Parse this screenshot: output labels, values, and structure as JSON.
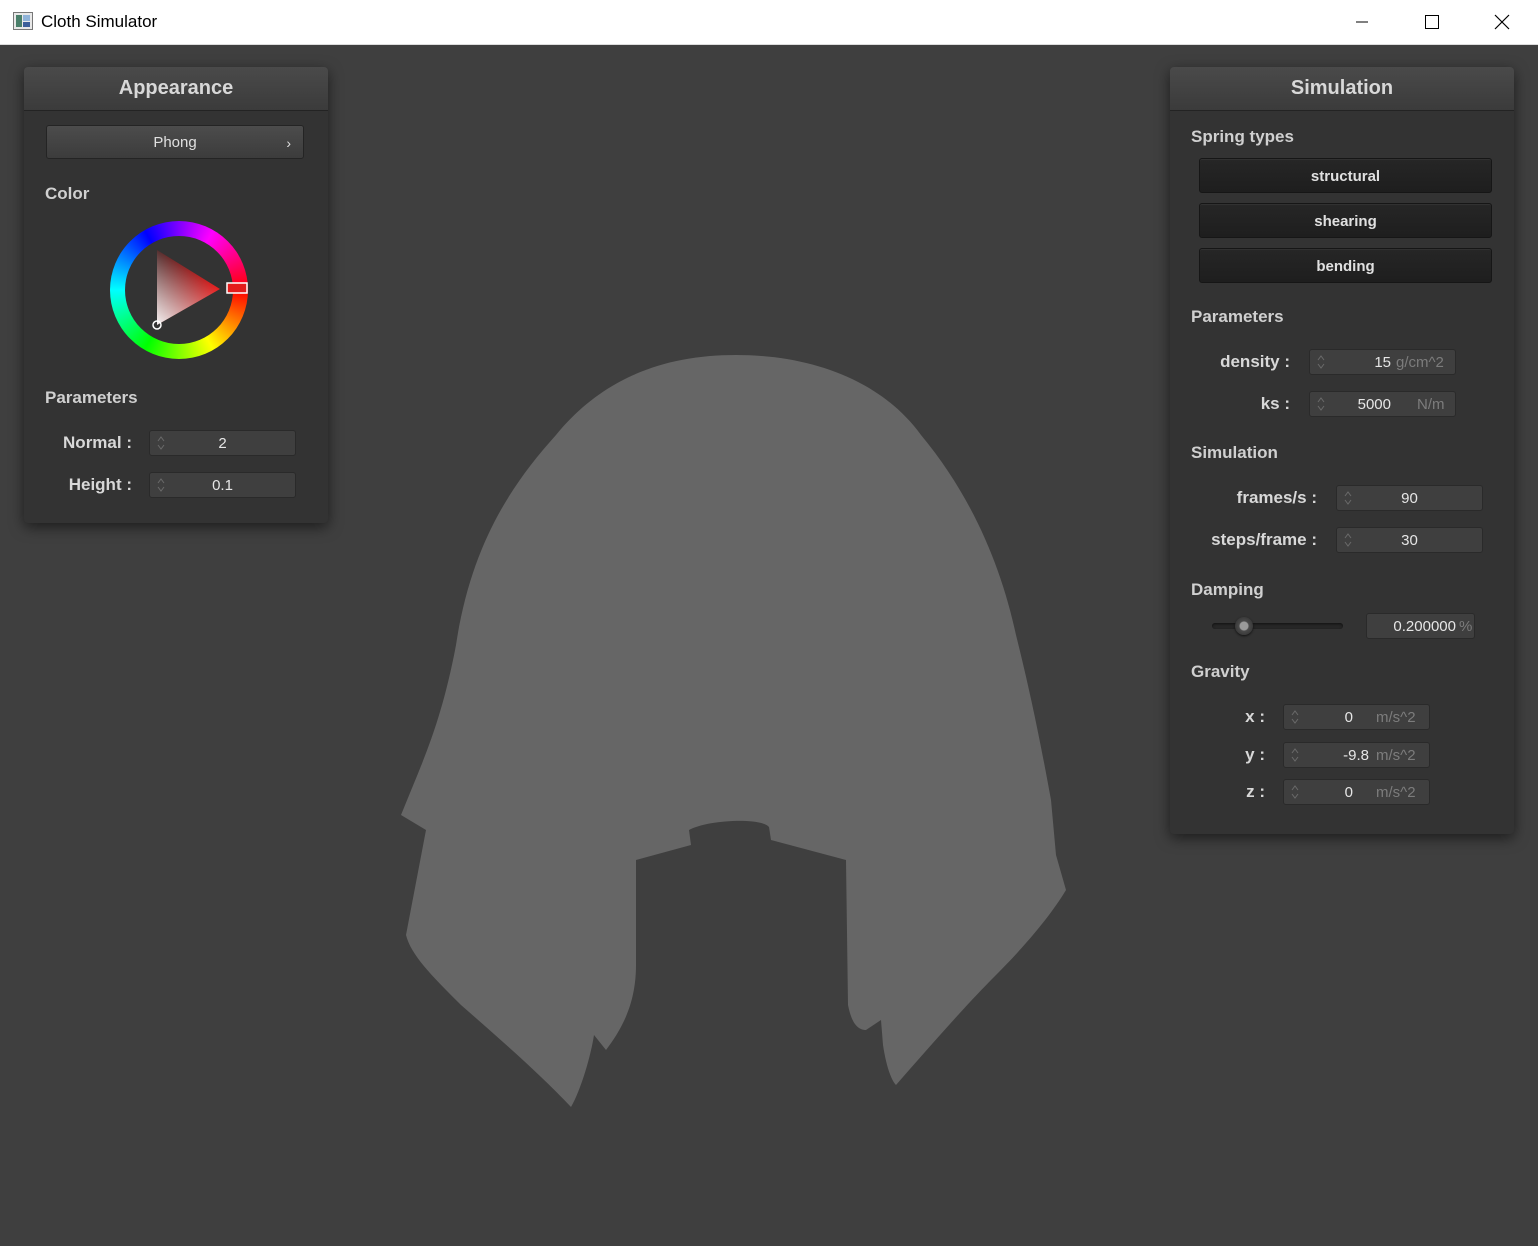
{
  "window": {
    "title": "Cloth Simulator"
  },
  "appearance": {
    "header": "Appearance",
    "shader_button": "Phong",
    "shader_chevron": "›",
    "color_label": "Color",
    "color_value": "#e31b1b",
    "parameters_label": "Parameters",
    "normal": {
      "label": "Normal :",
      "value": "2"
    },
    "height": {
      "label": "Height :",
      "value": "0.1"
    }
  },
  "simulation": {
    "header": "Simulation",
    "spring_types_label": "Spring types",
    "springs": [
      "structural",
      "shearing",
      "bending"
    ],
    "parameters_label": "Parameters",
    "density": {
      "label": "density :",
      "value": "15",
      "unit": "g/cm^2"
    },
    "ks": {
      "label": "ks :",
      "value": "5000",
      "unit": "N/m"
    },
    "simulation_label": "Simulation",
    "frames": {
      "label": "frames/s :",
      "value": "90"
    },
    "steps": {
      "label": "steps/frame :",
      "value": "30"
    },
    "damping_label": "Damping",
    "damping": {
      "value": "0.200000",
      "unit": "%",
      "slider_fraction": 0.2
    },
    "gravity_label": "Gravity",
    "gravity_x": {
      "label": "x :",
      "value": "0",
      "unit": "m/s^2"
    },
    "gravity_y": {
      "label": "y :",
      "value": "-9.8",
      "unit": "m/s^2"
    },
    "gravity_z": {
      "label": "z :",
      "value": "0",
      "unit": "m/s^2"
    }
  },
  "colors": {
    "background": "#3f3f3f",
    "cloth": "#666666",
    "panel": "#333333"
  }
}
